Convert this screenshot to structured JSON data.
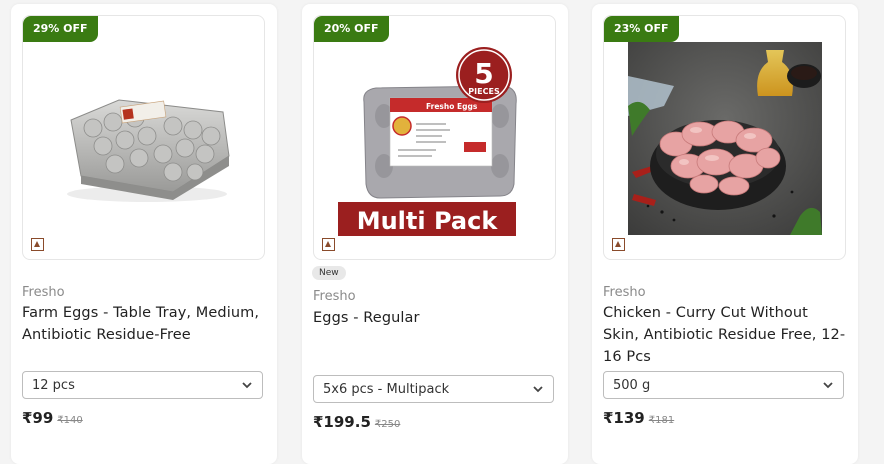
{
  "colors": {
    "badge": "#3a7b12",
    "page_bg": "#f4f4f4"
  },
  "products": [
    {
      "discount": "29% OFF",
      "brand": "Fresho",
      "title": "Farm Eggs - Table Tray, Medium, Antibiotic Residue-Free",
      "pack": "12 pcs",
      "price": "₹99",
      "mrp": "₹140",
      "image": "egg-tray-image"
    },
    {
      "discount": "20% OFF",
      "tag": "New",
      "brand": "Fresho",
      "title": "Eggs - Regular",
      "pack": "5x6 pcs - Multipack",
      "price": "₹199.5",
      "mrp": "₹250",
      "image": "egg-multipack-image",
      "image_text": {
        "pieces_num": "5",
        "pieces_word": "PIECES",
        "banner": "Multi Pack",
        "label": "Fresho Eggs"
      }
    },
    {
      "discount": "23% OFF",
      "brand": "Fresho",
      "title": "Chicken - Curry Cut Without Skin, Antibiotic Residue Free, 12-16 Pcs",
      "pack": "500 g",
      "price": "₹139",
      "mrp": "₹181",
      "image": "chicken-bowl-image"
    }
  ]
}
